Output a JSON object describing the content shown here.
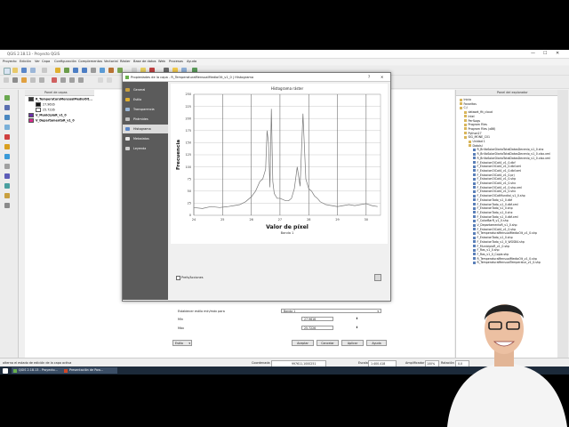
{
  "app": {
    "title": "QGIS 2.18.13 - Proyecto QGIS",
    "menu": [
      "Proyecto",
      "Edición",
      "Ver",
      "Capa",
      "Configuración",
      "Complementos",
      "Vectorial",
      "Ráster",
      "Base de datos",
      "Web",
      "Procesos",
      "Ayuda"
    ],
    "window_controls": [
      "—",
      "☐",
      "✕"
    ]
  },
  "layers_panel": {
    "title": "Panel de capas",
    "items": [
      {
        "label": "R_TemperaturaMensualMedioOlt...",
        "color": "#3a3a3a",
        "bold": true
      },
      {
        "label": "27.9616",
        "color": ""
      },
      {
        "label": "25.7226",
        "color": ""
      },
      {
        "label": "V_MunicipioR_v1_0",
        "color": "#6b2fa8",
        "bold": true
      },
      {
        "label": "V_DepartamentoR_v1_0",
        "color": "#d82a8c",
        "bold": true
      }
    ]
  },
  "browser_panel": {
    "title": "Panel del explorador",
    "items": [
      {
        "label": "Inicio",
        "indent": 0,
        "file": false
      },
      {
        "label": "Favoritos",
        "indent": 0,
        "file": false
      },
      {
        "label": "C:/",
        "indent": 0,
        "file": false
      },
      {
        "label": "dataset_ftt_cloud",
        "indent": 1,
        "file": false
      },
      {
        "label": "Intel",
        "indent": 1,
        "file": false
      },
      {
        "label": "PerfLogs",
        "indent": 1,
        "file": false
      },
      {
        "label": "Program Files",
        "indent": 1,
        "file": false
      },
      {
        "label": "Program Files (x86)",
        "indent": 1,
        "file": false
      },
      {
        "label": "Python27",
        "indent": 1,
        "file": false
      },
      {
        "label": "SIG_MONE_C01",
        "indent": 1,
        "file": false
      },
      {
        "label": "Unidad 1",
        "indent": 2,
        "file": false
      },
      {
        "label": "DatoIsl",
        "indent": 2,
        "file": false
      },
      {
        "label": "R_BrilloSolarDiarioTotalDatosDecenio_v1_0.shx",
        "indent": 3,
        "file": true
      },
      {
        "label": "R_BrilloSolarDiarioTotalDatosDecenio_v1_0.xlsx.xml",
        "indent": 3,
        "file": true
      },
      {
        "label": "R_BrilloSolarDiarioTotalDatosDecenio_v1_0.xlsx.xml",
        "indent": 3,
        "file": true
      },
      {
        "label": "F_EstacionOlCat4_v1_0.dbf",
        "indent": 3,
        "file": true
      },
      {
        "label": "F_EstacionOlCat4_v1_0.dbf.xml",
        "indent": 3,
        "file": true
      },
      {
        "label": "F_EstacionOlCat4_v1_0.dbf.xml",
        "indent": 3,
        "file": true
      },
      {
        "label": "F_EstacionOlCat4_v1_0.prj",
        "indent": 3,
        "file": true
      },
      {
        "label": "F_EstacionOlCat4_v1_0.shp",
        "indent": 3,
        "file": true
      },
      {
        "label": "F_EstacionOlCat4_v1_0.shx",
        "indent": 3,
        "file": true
      },
      {
        "label": "F_EstacionOlCat4_v1_0.shp.xml",
        "indent": 3,
        "file": true
      },
      {
        "label": "F_EstacionOlCat4_v1_0.shx",
        "indent": 3,
        "file": true
      },
      {
        "label": "F_EstacionOlCatMundial_v1_0.shp",
        "indent": 3,
        "file": true
      },
      {
        "label": "F_EstacionTodo_v1_0.dbf",
        "indent": 3,
        "file": true
      },
      {
        "label": "F_EstacionTodo_v1_0.dbf.xml",
        "indent": 3,
        "file": true
      },
      {
        "label": "F_EstacionTodo_v1_0.shp",
        "indent": 3,
        "file": true
      },
      {
        "label": "F_EstacionTodo_v1_0.shx",
        "indent": 3,
        "file": true
      },
      {
        "label": "F_EstacionTodo_v1_0.dbf.xml",
        "indent": 3,
        "file": true
      },
      {
        "label": "F_ColorBarR_v1_0.shp",
        "indent": 3,
        "file": true
      },
      {
        "label": "V_DepartamentoR_v1_0.shp",
        "indent": 3,
        "file": true
      },
      {
        "label": "F_EstacionOlCat4_v1_0.shp",
        "indent": 3,
        "file": true
      },
      {
        "label": "R_TemperaturaMensualMedioOlt_v1_0.shp",
        "indent": 3,
        "file": true
      },
      {
        "label": "F_EstacionTodo_v1_0.shp",
        "indent": 3,
        "file": true
      },
      {
        "label": "F_EstacionTodo_v1_0_WGS84.shp",
        "indent": 3,
        "file": true
      },
      {
        "label": "F_MunicipioR_v1_0.shp",
        "indent": 3,
        "file": true
      },
      {
        "label": "F_Ras_v1_0.shp",
        "indent": 3,
        "file": true
      },
      {
        "label": "F_Ras_v1_0_Copia.shp",
        "indent": 3,
        "file": true
      },
      {
        "label": "R_TemperaturaMensualMedioOlt_v1_0.shp",
        "indent": 3,
        "file": true
      },
      {
        "label": "R_TemperaturaMensualTemperatur_v1_0.shp",
        "indent": 3,
        "file": true
      }
    ]
  },
  "dialog": {
    "title": "Propiedades de la capa - R_TemperaturaMensualMedioOlt_v1_0 | Histograma",
    "nav": [
      "General",
      "Estilo",
      "Transparencia",
      "Pirámides",
      "Histograma",
      "Metadatos",
      "Leyenda"
    ],
    "selected_nav": 4,
    "prefs_label": "Prefs/Acciones",
    "band_label": "Establecer estilo mín/máx para",
    "band_value": "Banda 1",
    "min_label": "Mín",
    "min_value": "27.9616",
    "max_label": "Máx",
    "max_value": "25.7226",
    "style_label": "Estilo",
    "buttons": {
      "ok": "Aceptar",
      "cancel": "Cancelar",
      "apply": "Aplicar",
      "help": "Ayuda"
    }
  },
  "statusbar": {
    "message": "alterna el estado de edición de la capa activa",
    "coord_label": "Coordenada",
    "coord_value": "997611,1000251",
    "scale_label": "Escala",
    "scale_value": "1:400.418",
    "magnifier_label": "Amplificador",
    "magnifier_value": "100%",
    "rotation_label": "Rotación",
    "rotation_value": "0,0"
  },
  "taskbar": {
    "items": [
      "QGIS 2.18.13 - Proyecto...",
      "Presentación de Pow..."
    ]
  },
  "chart_data": {
    "type": "line",
    "title": "Histograma ráster",
    "xlabel": "Valor de píxel",
    "ylabel": "Frecuencia",
    "legend": [
      "Banda 1"
    ],
    "xlim": [
      24.0,
      30.5
    ],
    "ylim": [
      0,
      250
    ],
    "xticks": [
      24,
      25,
      26,
      27,
      28,
      29,
      30
    ],
    "xtick_labels": [
      "24",
      "25",
      "26",
      "27",
      "28",
      "29",
      "30"
    ],
    "yticks": [
      0,
      25,
      50,
      75,
      100,
      125,
      150,
      175,
      200,
      225,
      250
    ],
    "grid": true,
    "series": [
      {
        "name": "Banda 1",
        "color": "#777777",
        "x": [
          24.0,
          24.3,
          24.6,
          24.9,
          25.2,
          25.4,
          25.6,
          25.8,
          26.0,
          26.15,
          26.3,
          26.4,
          26.5,
          26.55,
          26.6,
          26.65,
          26.7,
          26.75,
          26.8,
          26.9,
          27.0,
          27.2,
          27.3,
          27.4,
          27.5,
          27.6,
          27.7,
          27.8,
          27.9,
          28.0,
          28.1,
          28.2,
          28.3,
          28.4,
          28.6,
          28.8,
          29.0,
          29.2,
          29.4,
          29.6,
          29.8,
          30.0,
          30.2,
          30.4
        ],
        "y": [
          16,
          14,
          18,
          16,
          18,
          20,
          22,
          28,
          38,
          50,
          70,
          75,
          95,
          175,
          150,
          58,
          220,
          70,
          45,
          35,
          35,
          30,
          30,
          35,
          55,
          100,
          60,
          210,
          75,
          55,
          50,
          40,
          35,
          28,
          22,
          20,
          18,
          20,
          22,
          20,
          22,
          24,
          20,
          18
        ]
      }
    ]
  }
}
